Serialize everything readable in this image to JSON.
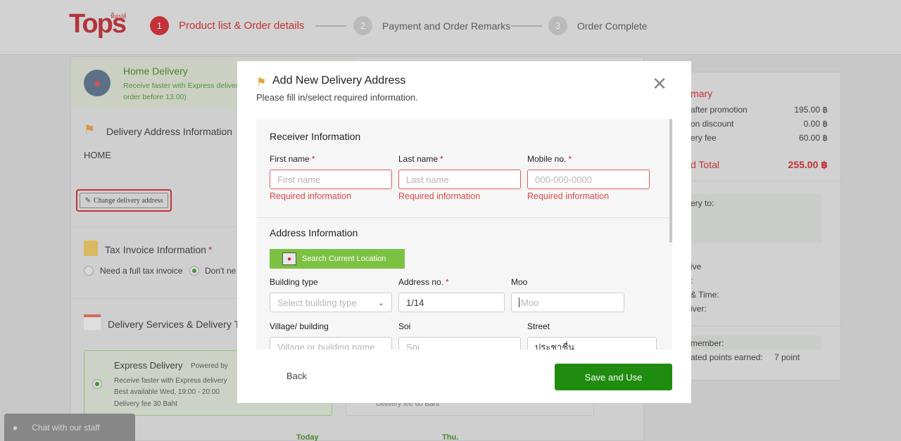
{
  "header": {
    "logo": "Tops",
    "logo_sub": "ท็อปส์",
    "steps": [
      {
        "num": "1",
        "label": "Product list & Order details"
      },
      {
        "num": "2",
        "label": "Payment and Order Remarks"
      },
      {
        "num": "3",
        "label": "Order Complete"
      }
    ]
  },
  "background": {
    "banner": {
      "title": "Home Delivery",
      "subtitle": "Receive faster with Express delivery",
      "subtitle2": "order before 13.00)"
    },
    "address": {
      "title": "Delivery Address Information",
      "name": "HOME",
      "change_label": "Change delivery address"
    },
    "tax": {
      "title": "Tax Invoice Information",
      "option_full": "Need a full tax invoice",
      "option_no": "Don't ne"
    },
    "services": {
      "title": "Delivery Services & Delivery Tin",
      "express_title": "Express Delivery",
      "powered_by": "Powered by",
      "express_line1": "Receive faster with Express delivery",
      "express_line2": "Best available Wed, 19:00 - 20:00",
      "express_line3": "Delivery fee 30 Baht",
      "std_fee": "Delivery fee 60 Baht",
      "day_today": "Today",
      "day_thu": "Thu."
    },
    "summary": {
      "title": "mary",
      "rows": [
        {
          "label": "after promotion",
          "value": "195.00 ฿"
        },
        {
          "label": "on discount",
          "value": "0.00 ฿"
        },
        {
          "label": "ery fee",
          "value": "60.00 ฿"
        }
      ],
      "total_label": "d Total",
      "total_value": "255.00 ฿",
      "delivery_to": "ery to:",
      "info_lines": [
        "ive",
        ":",
        "& Time:",
        "iver:"
      ],
      "member": "member:",
      "points_label": "ated points earned:",
      "points_value": "7 point"
    },
    "chat": "Chat with our staff"
  },
  "modal": {
    "title": "Add New Delivery Address",
    "subtitle": "Please fill in/select required information.",
    "receiver_title": "Receiver Information",
    "first_name": {
      "label": "First name",
      "placeholder": "First name",
      "error": "Required information"
    },
    "last_name": {
      "label": "Last name",
      "placeholder": "Last name",
      "error": "Required information"
    },
    "mobile": {
      "label": "Mobile no.",
      "placeholder": "000-000-0000",
      "error": "Required information"
    },
    "required_mark": "*",
    "address_title": "Address Information",
    "location_button": "Search Current Location",
    "building_type": {
      "label": "Building type",
      "placeholder": "Select building type"
    },
    "address_no": {
      "label": "Address no.",
      "value": "1/14"
    },
    "moo": {
      "label": "Moo",
      "placeholder": "Moo"
    },
    "village": {
      "label": "Village/ building",
      "placeholder": "Village or building name"
    },
    "soi": {
      "label": "Soi",
      "placeholder": "Soi"
    },
    "street": {
      "label": "Street",
      "value": "ประชาชื่น"
    },
    "back_label": "Back",
    "save_label": "Save and Use"
  },
  "colors": {
    "accent_red": "#d2232a",
    "save_green": "#1f8c10",
    "location_green": "#7cc242"
  }
}
